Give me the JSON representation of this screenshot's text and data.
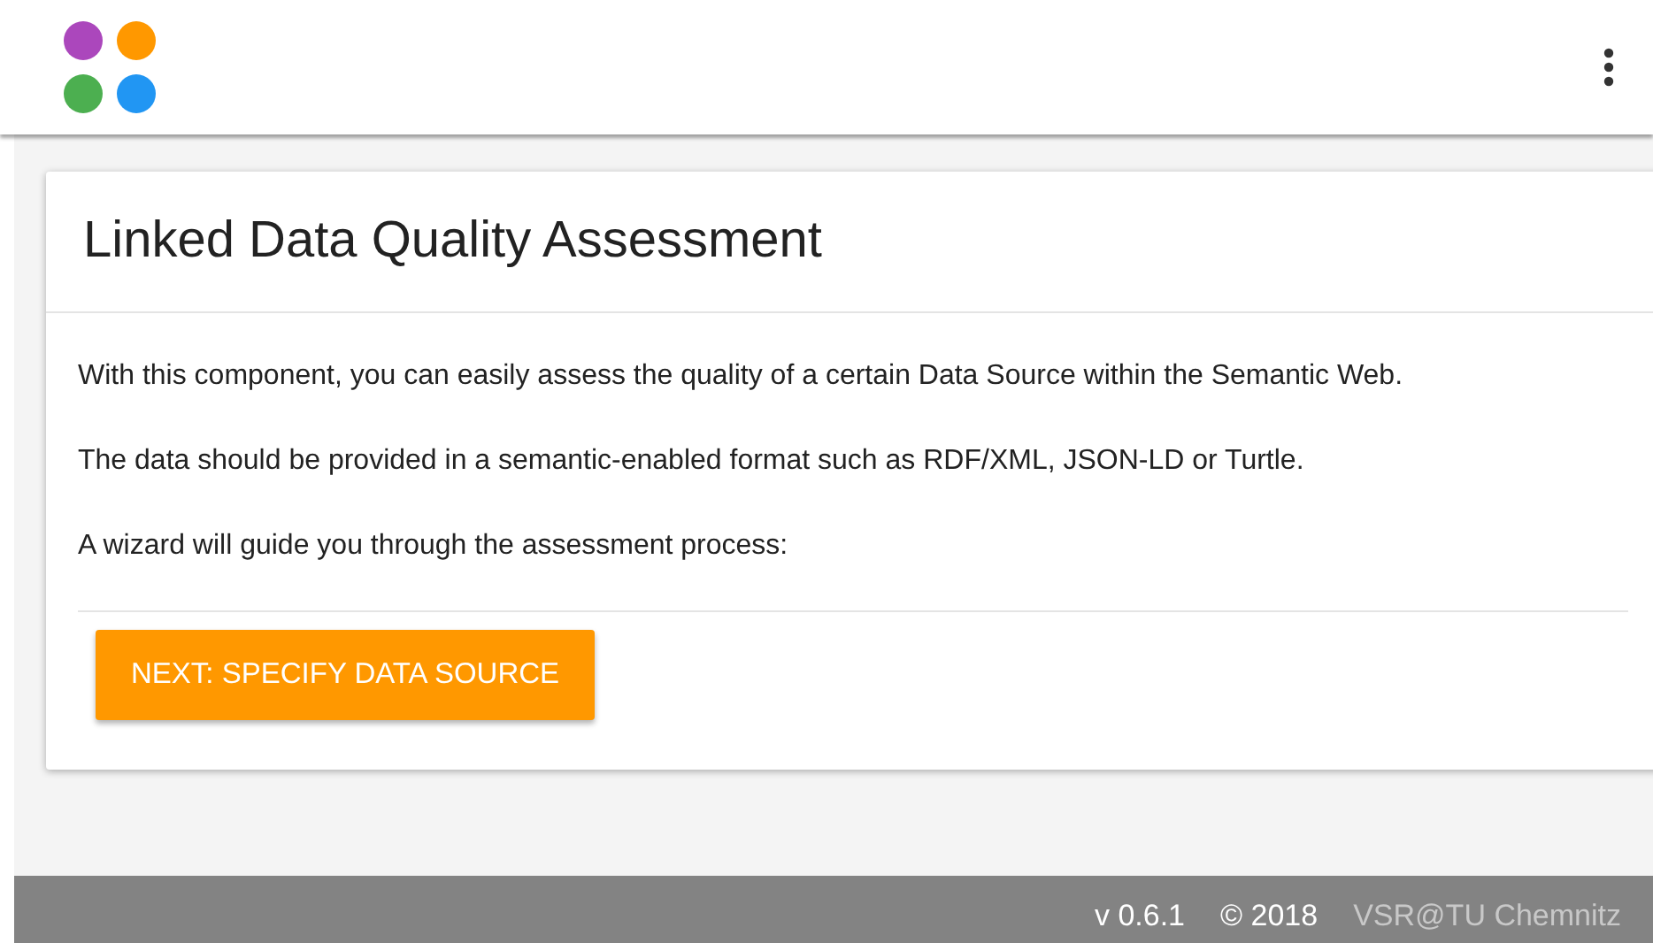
{
  "logo": {
    "dots": [
      {
        "color": "#ab47bc"
      },
      {
        "color": "#ff9800"
      },
      {
        "color": "#4caf50"
      },
      {
        "color": "#2196f3"
      }
    ]
  },
  "card": {
    "title": "Linked Data Quality Assessment",
    "paragraphs": [
      "With this component, you can easily assess the quality of a certain Data Source within the Semantic Web.",
      "The data should be provided in a semantic-enabled format such as RDF/XML, JSON-LD or Turtle.",
      "A wizard will guide you through the assessment process:"
    ],
    "button": "NEXT: SPECIFY DATA SOURCE"
  },
  "footer": {
    "version": "v 0.6.1",
    "copyright": "© 2018",
    "link": "VSR@TU Chemnitz"
  }
}
